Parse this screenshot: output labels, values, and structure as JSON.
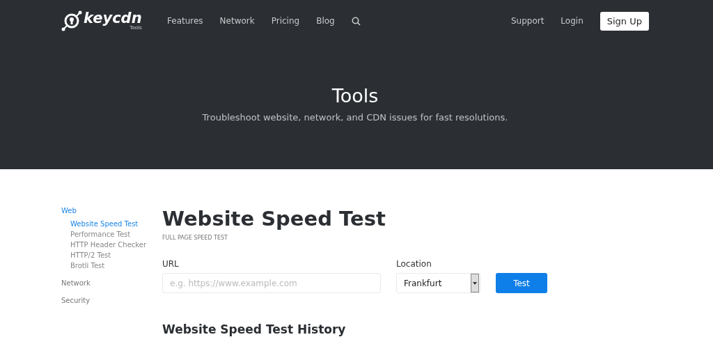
{
  "logo": {
    "name": "keycdn",
    "sub": "Tools"
  },
  "nav": {
    "links": [
      "Features",
      "Network",
      "Pricing",
      "Blog"
    ],
    "right": [
      "Support",
      "Login"
    ],
    "signup": "Sign Up"
  },
  "hero": {
    "title": "Tools",
    "subtitle": "Troubleshoot website, network, and CDN issues for fast resolutions."
  },
  "sidebar": [
    {
      "label": "Web",
      "selected": true,
      "children": [
        {
          "label": "Website Speed Test",
          "selected": true
        },
        {
          "label": "Performance Test",
          "selected": false
        },
        {
          "label": "HTTP Header Checker",
          "selected": false
        },
        {
          "label": "HTTP/2 Test",
          "selected": false
        },
        {
          "label": "Brotli Test",
          "selected": false
        }
      ]
    },
    {
      "label": "Network",
      "selected": false
    },
    {
      "label": "Security",
      "selected": false
    }
  ],
  "main": {
    "title": "Website Speed Test",
    "subtitle": "FULL PAGE SPEED TEST",
    "url": {
      "label": "URL",
      "placeholder": "e.g. https://www.example.com"
    },
    "location": {
      "label": "Location",
      "value": "Frankfurt"
    },
    "button": "Test",
    "history_title": "Website Speed Test History"
  }
}
